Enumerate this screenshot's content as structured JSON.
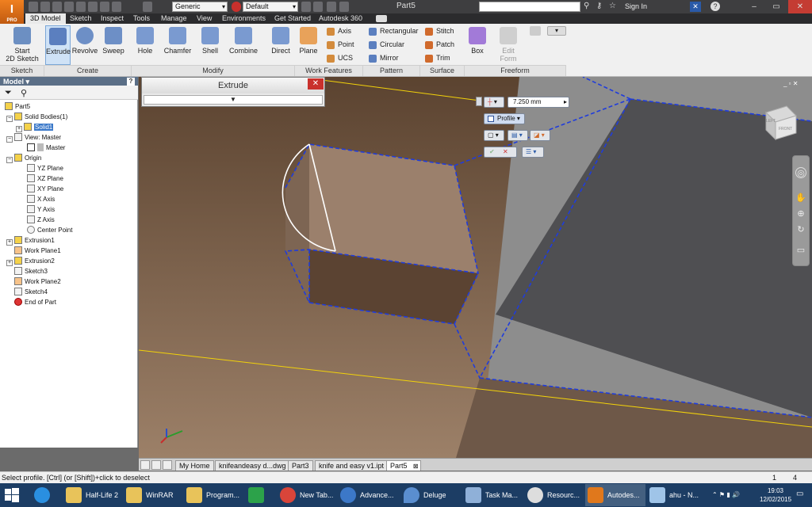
{
  "app": {
    "logo_text": "I",
    "logo_sub": "PRO",
    "doc_title": "Part5",
    "signin": "Sign In",
    "search_placeholder": ""
  },
  "quickaccess": {
    "material": "Generic",
    "appearance": "Default"
  },
  "ribbon_tabs": [
    "3D Model",
    "Sketch",
    "Inspect",
    "Tools",
    "Manage",
    "View",
    "Environments",
    "Get Started",
    "Autodesk 360"
  ],
  "ribbon": {
    "start_sketch": "Start\n2D Sketch",
    "create": [
      "Extrude",
      "Revolve",
      "Sweep"
    ],
    "modify": [
      "Hole",
      "Chamfer",
      "Shell",
      "Combine"
    ],
    "direct": "Direct",
    "plane": "Plane",
    "work": [
      "Axis",
      "Point",
      "UCS"
    ],
    "pattern": [
      "Rectangular",
      "Circular",
      "Mirror"
    ],
    "surface": [
      "Stitch",
      "Patch",
      "Trim"
    ],
    "box": "Box",
    "edit_form": "Edit\nForm",
    "groups": [
      "Sketch",
      "Create",
      "Modify",
      "Work Features",
      "Pattern",
      "Surface",
      "Freeform"
    ]
  },
  "browser": {
    "title": "Model",
    "items": [
      "Part5",
      "Solid Bodies(1)",
      "Solid1",
      "View: Master",
      "Master",
      "Origin",
      "YZ Plane",
      "XZ Plane",
      "XY Plane",
      "X Axis",
      "Y Axis",
      "Z Axis",
      "Center Point",
      "Extrusion1",
      "Work Plane1",
      "Extrusion2",
      "Sketch3",
      "Work Plane2",
      "Sketch4",
      "End of Part"
    ]
  },
  "extrude_dialog": {
    "title": "Extrude",
    "close": "✕",
    "expand": "▼"
  },
  "minitoolbar": {
    "distance": "7.250 mm",
    "profile": "Profile"
  },
  "viewcube": {
    "face_front": "FRONT",
    "face_left": "LEFT"
  },
  "doc_tabs": [
    "My Home",
    "knifeandeasy d...dwg",
    "Part3",
    "knife and easy v1.ipt",
    "Part5"
  ],
  "status": {
    "message": "Select profile. [Ctrl] (or [Shift])+click to deselect",
    "count1": "1",
    "count2": "4"
  },
  "taskbar": {
    "items": [
      "Half-Life 2",
      "WinRAR",
      "Program...",
      "",
      "New Tab...",
      "Advance...",
      "Deluge",
      "Task Ma...",
      "Resourc...",
      "Autodes...",
      "ahu - N..."
    ],
    "time": "19:03",
    "date": "12/02/2015"
  },
  "colors": {
    "accent": "#3a78c9",
    "titlebar": "#3e3e40",
    "taskbar": "#1c3d64",
    "sketch_edge": "#1f3cdc"
  }
}
